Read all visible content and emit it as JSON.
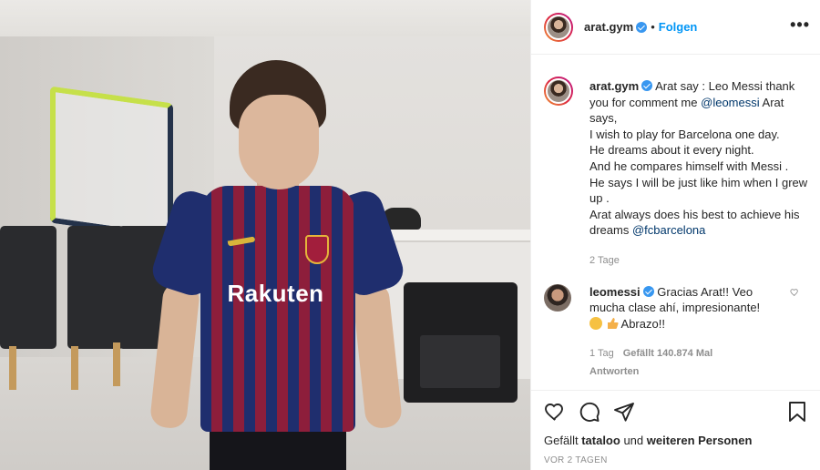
{
  "header": {
    "username": "arat.gym",
    "separator": "•",
    "follow_label": "Folgen",
    "more_icon": "more-icon",
    "more_label": "•••"
  },
  "caption": {
    "username": "arat.gym",
    "line1": "Arat say : Leo Messi thank you for comment me",
    "mention1": "@leomessi",
    "line1_end": "Arat says,",
    "line2": "I wish to play for Barcelona one day.",
    "line3": "He dreams about it every night.",
    "line4": "And he compares himself with Messi .",
    "line5": "He says I will be just like him when I grew up .",
    "line6": "Arat always does his best to achieve his dreams",
    "mention2": "@fcbarcelona",
    "time": "2 Tage"
  },
  "reply": {
    "username": "leomessi",
    "text": "Gracias Arat!! Veo mucha clase ahí, impresionante!",
    "text_end": "Abrazo!!",
    "time": "1 Tag",
    "likes": "Gefällt 140.874 Mal",
    "reply_label": "Antworten"
  },
  "media": {
    "sponsor": "Rakuten"
  },
  "footer": {
    "likes_prefix": "Gefällt",
    "likes_user": "tataloo",
    "likes_mid": "und",
    "likes_others": "weiteren Personen",
    "timestamp": "VOR 2 TAGEN"
  },
  "colors": {
    "link": "#0095f6",
    "verified": "#3897f0",
    "mention": "#00376b",
    "muted": "#8e8e8e"
  }
}
